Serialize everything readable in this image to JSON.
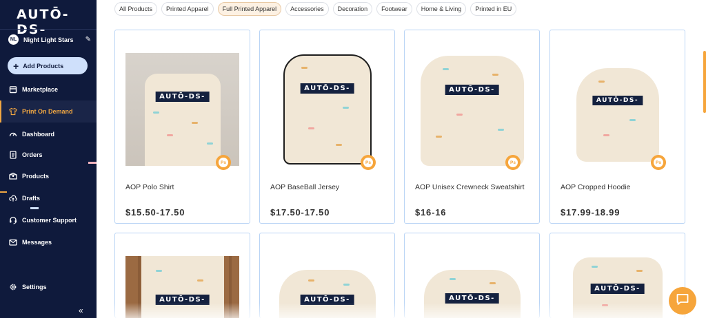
{
  "sidebar": {
    "logo": "AUTŌ-DS-",
    "store": {
      "initials": "NL",
      "name": "Night Light Stars"
    },
    "add_products_label": "Add Products",
    "items": [
      {
        "label": "Marketplace",
        "icon": "store-icon"
      },
      {
        "label": "Print On Demand",
        "icon": "shirt-icon",
        "active": true
      },
      {
        "label": "Dashboard",
        "icon": "gauge-icon"
      },
      {
        "label": "Orders",
        "icon": "clipboard-icon"
      },
      {
        "label": "Products",
        "icon": "box-icon"
      },
      {
        "label": "Drafts",
        "icon": "cloud-upload-icon"
      },
      {
        "label": "Customer Support",
        "icon": "headset-icon"
      },
      {
        "label": "Messages",
        "icon": "envelope-icon"
      },
      {
        "label": "Settings",
        "icon": "gear-icon"
      }
    ],
    "collapse_glyph": "«"
  },
  "filters": [
    {
      "label": "All Products"
    },
    {
      "label": "Printed Apparel"
    },
    {
      "label": "Full Printed Apparel",
      "active": true
    },
    {
      "label": "Accessories"
    },
    {
      "label": "Decoration"
    },
    {
      "label": "Footwear"
    },
    {
      "label": "Home & Living"
    },
    {
      "label": "Printed in EU"
    }
  ],
  "products": [
    {
      "name": "AOP Polo Shirt",
      "price": "$15.50-17.50",
      "badge": "Ps"
    },
    {
      "name": "AOP BaseBall Jersey",
      "price": "$17.50-17.50",
      "badge": "Ps"
    },
    {
      "name": "AOP Unisex Crewneck Sweatshirt",
      "price": "$16-16",
      "badge": "Ps"
    },
    {
      "name": "AOP Cropped Hoodie",
      "price": "$17.99-18.99",
      "badge": "Ps"
    }
  ],
  "print_logo": "AUTŌ-DS-",
  "colors": {
    "sidebar": "#0f1a3c",
    "accent": "#f6a53b",
    "card_border": "#b9d4f5"
  }
}
